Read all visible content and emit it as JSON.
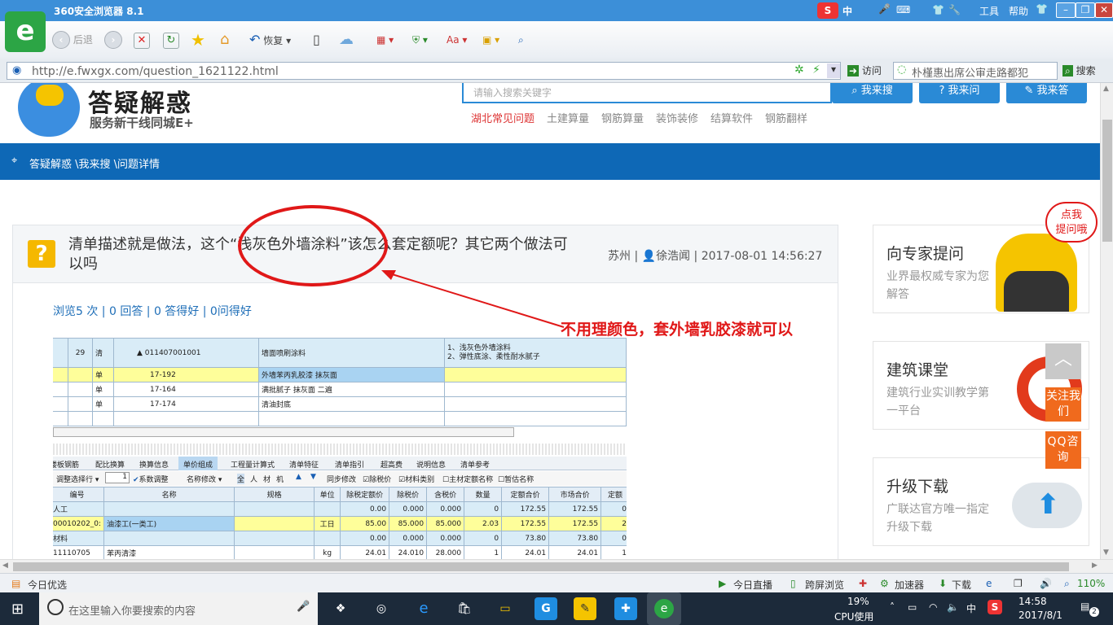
{
  "browser": {
    "title": "360安全浏览器 8.1",
    "menu": [
      "工具",
      "帮助"
    ],
    "nav": {
      "back_label": "后退",
      "restore_label": "恢复"
    },
    "address": {
      "url": "http://e.fwxgx.com/question_1621122.html",
      "visit_label": "访问",
      "search_text": "朴槿惠出席公审走路都犯",
      "search_button": "搜索"
    },
    "ime_label": "中"
  },
  "site": {
    "logo_title": "答疑解惑",
    "logo_subtitle": "服务新干线同城E+",
    "search_placeholder": "请输入搜索关键字",
    "buttons": [
      "我来搜",
      "我来问",
      "我来答"
    ],
    "nav_links": [
      "湖北常见问题",
      "土建算量",
      "钢筋算量",
      "装饰装修",
      "结算软件",
      "钢筋翻样"
    ],
    "breadcrumb": "答疑解惑 \\我来搜 \\问题详情"
  },
  "question": {
    "title": "清单描述就是做法，这个“浅灰色外墙涂料”该怎么套定额呢？其它两个做法可以吗",
    "location": "苏州",
    "author": "徐浩闻",
    "datetime": "2017-08-01 14:56:27",
    "stats": "浏览5 次 | 0 回答 | 0 答得好 | 0问得好",
    "annotation": "不用理颜色，套外墙乳胶漆就可以"
  },
  "software": {
    "top_rows": [
      [
        "",
        "29",
        "清",
        "▲ 011407001001",
        "墙面喷刷涂料",
        "1、浅灰色外墙涂料\n2、弹性底涂、柔性耐水腻子"
      ],
      [
        "",
        "",
        "单",
        "17-192",
        "外墙苯丙乳胶漆 抹灰面",
        ""
      ],
      [
        "",
        "",
        "单",
        "17-164",
        "满批腻子 抹灰面 二遍",
        ""
      ],
      [
        "",
        "",
        "单",
        "17-174",
        "清油封底",
        ""
      ]
    ],
    "tabs": [
      "楼板钢筋",
      "配比换算",
      "换算信息",
      "单价组成",
      "工程量计算式",
      "清单特征",
      "清单指引",
      "超高费",
      "说明信息",
      "清单参考"
    ],
    "active_tab": "单价组成",
    "options": {
      "adjust_label": "调整选择行",
      "qty": "1",
      "coef_label": "系数调整",
      "rename_label": "名称修改",
      "chars": [
        "全",
        "人",
        "材",
        "机"
      ],
      "sync_label": "同步修改",
      "checks": [
        "除税价",
        "材料类别",
        "主材定额名称",
        "暂估名称"
      ]
    },
    "columns": [
      "编号",
      "名称",
      "规格",
      "单位",
      "除税定额价",
      "除税价",
      "含税价",
      "数量",
      "定额合价",
      "市场合价",
      "定额"
    ],
    "rows": [
      [
        "人工",
        "",
        "",
        "",
        "0.00",
        "0.000",
        "0.000",
        "0",
        "172.55",
        "172.55",
        "0"
      ],
      [
        "00010202_0:",
        "油漆工(一类工)",
        "",
        "工日",
        "85.00",
        "85.000",
        "85.000",
        "2.03",
        "172.55",
        "172.55",
        "2"
      ],
      [
        "材料",
        "",
        "",
        "",
        "0.00",
        "0.000",
        "0.000",
        "0",
        "73.80",
        "73.80",
        "0"
      ],
      [
        "11110705",
        "苯丙清漆",
        "",
        "kg",
        "24.01",
        "24.010",
        "28.000",
        "1",
        "24.01",
        "24.01",
        "1"
      ]
    ]
  },
  "sidebar": {
    "bubble": "点我\n提问哦",
    "boxes": [
      {
        "title": "向专家提问",
        "sub": "业界最权威专家为您解答"
      },
      {
        "title": "建筑课堂",
        "sub": "建筑行业实训教学第一平台"
      },
      {
        "title": "升级下载",
        "sub": "广联达官方唯一指定升级下载"
      }
    ],
    "follow": "关注我们",
    "qq": "QQ咨询"
  },
  "statusbar": {
    "left": "今日优选",
    "items": [
      "今日直播",
      "跨屏浏览",
      "加速器",
      "下载"
    ],
    "zoom": "110%"
  },
  "taskbar": {
    "search_placeholder": "在这里输入你要搜索的内容",
    "cpu_percent": "19%",
    "cpu_label": "CPU使用",
    "ime": "中",
    "time": "14:58",
    "date": "2017/8/1",
    "notifications": "2"
  }
}
